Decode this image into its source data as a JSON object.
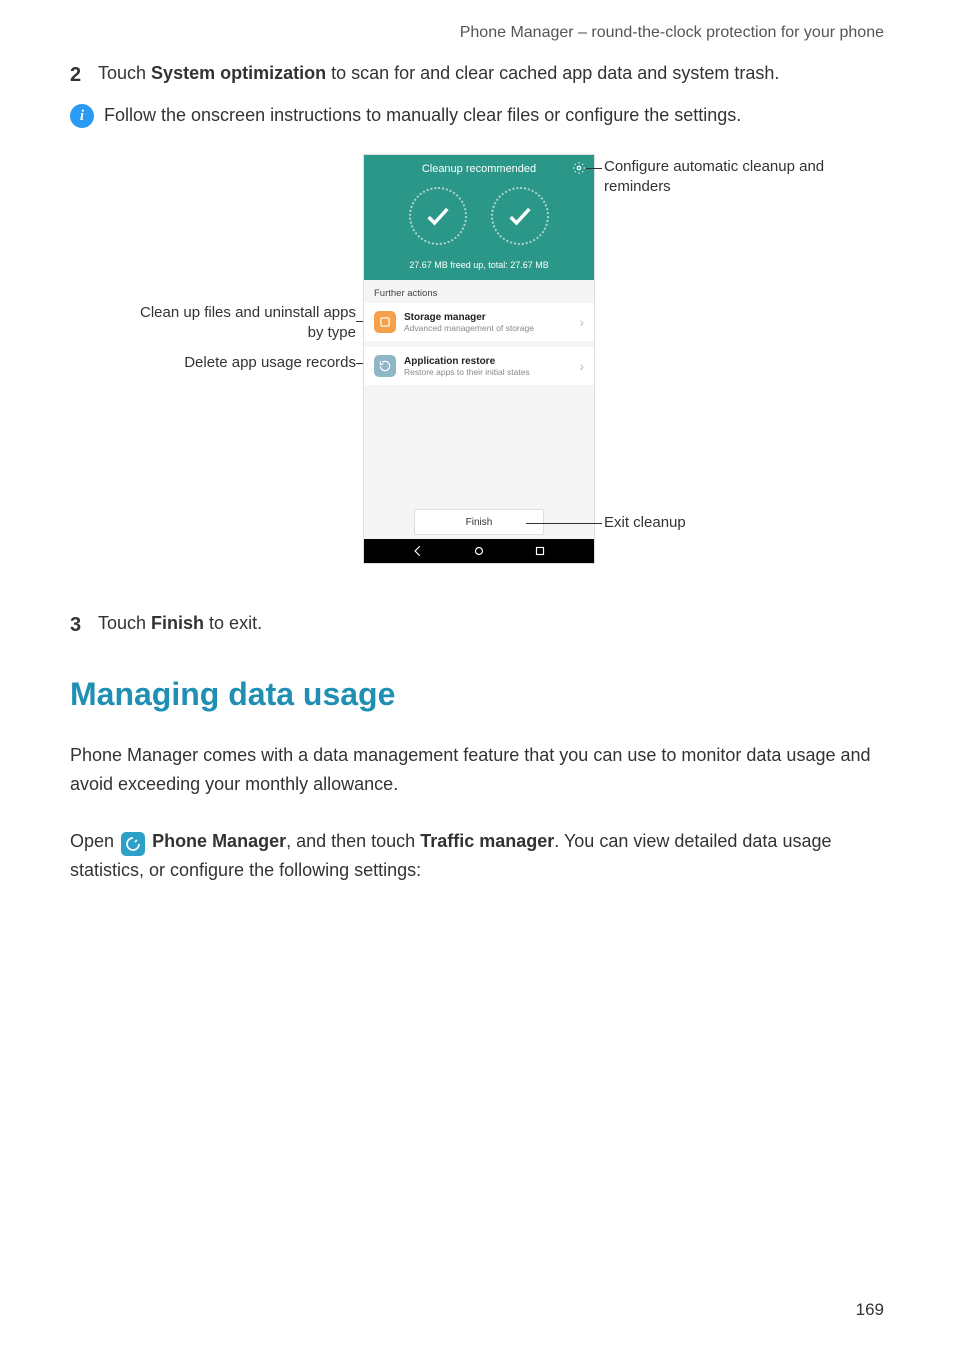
{
  "header": "Phone Manager – round-the-clock protection for your phone",
  "step2": {
    "num": "2",
    "text_before": "Touch ",
    "bold": "System optimization",
    "text_after": " to scan for and clear cached app data and system trash."
  },
  "info_text": "Follow the onscreen instructions to manually clear files or configure the settings.",
  "callouts": {
    "left1": "Clean up files and uninstall apps by type",
    "left2": "Delete app usage records",
    "right1": "Configure automatic cleanup and reminders",
    "right2": "Exit cleanup"
  },
  "phone": {
    "title": "Cleanup recommended",
    "freed": "27.67 MB freed up, total: 27.67 MB",
    "further": "Further actions",
    "storage_title": "Storage manager",
    "storage_sub": "Advanced management of storage",
    "apprestore_title": "Application restore",
    "apprestore_sub": "Restore apps to their initial states",
    "finish": "Finish"
  },
  "step3": {
    "num": "3",
    "text_before": "Touch ",
    "bold": "Finish",
    "text_after": " to exit."
  },
  "section_heading": "Managing data usage",
  "para1": "Phone Manager comes with a data management feature that you can use to monitor data usage and avoid exceeding your monthly allowance.",
  "para2": {
    "t1": "Open ",
    "bold1": "Phone Manager",
    "t2": ", and then touch ",
    "bold2": "Traffic manager",
    "t3": ". You can view detailed data usage statistics, or configure the following settings:"
  },
  "pagenum": "169"
}
